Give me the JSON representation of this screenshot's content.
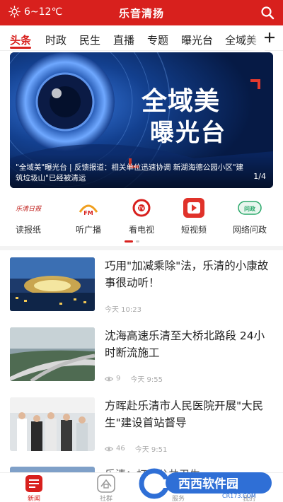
{
  "header": {
    "weather": "6~12℃",
    "title": "乐音清扬"
  },
  "tabs": [
    "头条",
    "时政",
    "民生",
    "直播",
    "专题",
    "曝光台",
    "全域美"
  ],
  "banner": {
    "title_line1": "全域美",
    "title_line2": "曝光台",
    "caption": "\"全域美\"曝光台 | 反馈报道：相关单位迅速协调 新湖海德公园小区\"建筑垃圾山\"已经被清运",
    "page": "1/4"
  },
  "quick_entries": [
    {
      "label": "读报纸",
      "icon": "newspaper-icon",
      "icon_text": "乐清日报"
    },
    {
      "label": "听广播",
      "icon": "radio-icon",
      "icon_text": "FM"
    },
    {
      "label": "看电视",
      "icon": "tv-icon",
      "icon_text": "TV"
    },
    {
      "label": "短视频",
      "icon": "video-play-icon",
      "icon_text": ""
    },
    {
      "label": "网络问政",
      "icon": "wenzheng-icon",
      "icon_text": "问政"
    }
  ],
  "news": [
    {
      "title": "巧用\"加减乘除\"法，乐清的小康故事很动听！",
      "views": "",
      "time": "今天 10:23"
    },
    {
      "title": "沈海高速乐清至大桥北路段 24小时断流施工",
      "views": "9",
      "time": "今天 9:55"
    },
    {
      "title": "方晖赴乐清市人民医院开展\"大民生\"建设首站督导",
      "views": "46",
      "time": "今天 9:51"
    }
  ],
  "partial_news_title": "乐清：打造公共卫生...",
  "bottom_nav": [
    {
      "label": "新闻",
      "active": true
    },
    {
      "label": "社群",
      "active": false
    },
    {
      "label": "服务",
      "active": false
    },
    {
      "label": "我的",
      "active": false
    }
  ],
  "watermark": {
    "brand": "西西软件园",
    "url": "CR173.COM"
  },
  "colors": {
    "brand_red": "#d8201d"
  }
}
